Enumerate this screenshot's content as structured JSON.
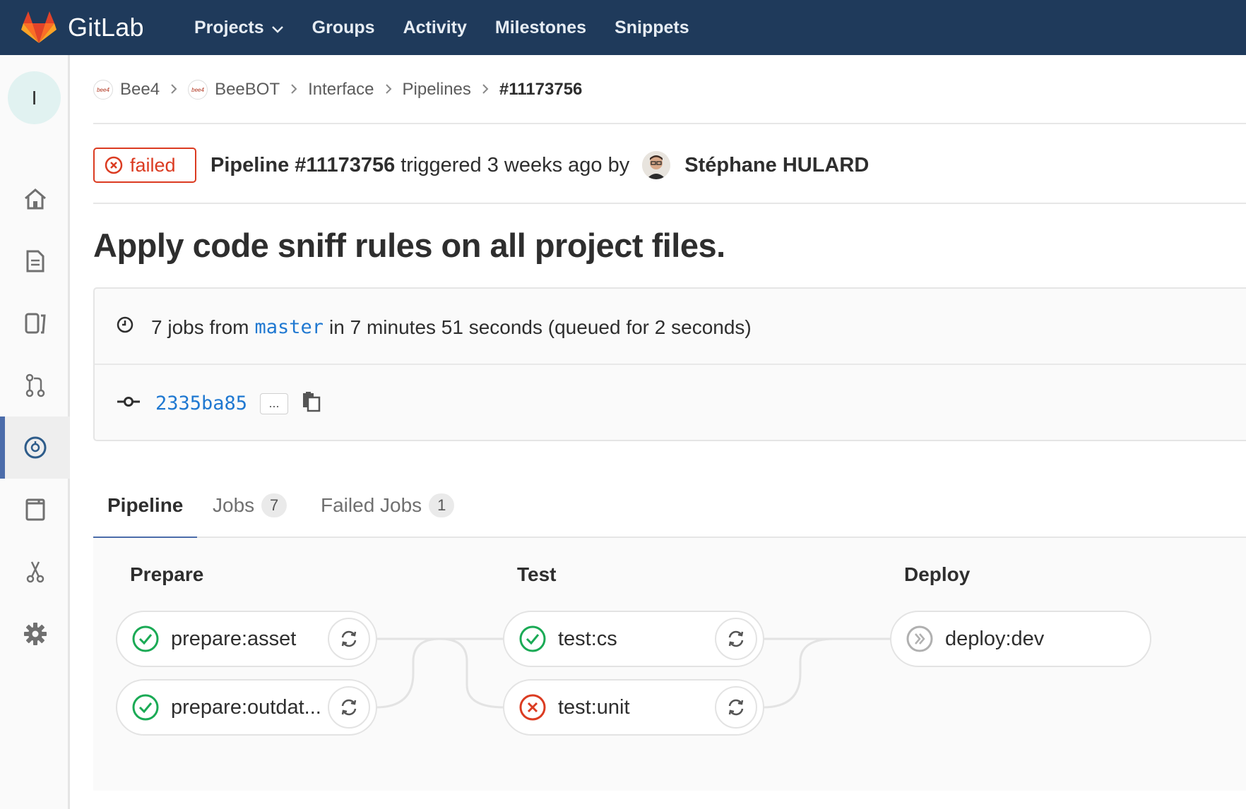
{
  "topnav": {
    "brand": "GitLab",
    "items": [
      "Projects",
      "Groups",
      "Activity",
      "Milestones",
      "Snippets"
    ]
  },
  "sidebar": {
    "avatar_letter": "I",
    "items": [
      "home",
      "overview",
      "issues",
      "merge-requests",
      "ci-cd",
      "wiki",
      "snippets",
      "settings"
    ],
    "active_item": "ci-cd"
  },
  "breadcrumb": {
    "items": [
      "Bee4",
      "BeeBOT",
      "Interface",
      "Pipelines"
    ],
    "current": "#11173756",
    "project_avatar_text": "bee4"
  },
  "pipeline": {
    "status": "failed",
    "title_prefix": "Pipeline #11173756",
    "triggered_text": "triggered 3 weeks ago by",
    "user": "Stéphane HULARD",
    "commit_title": "Apply code sniff rules on all project files.",
    "jobs_count_text": "7 jobs from",
    "branch": "master",
    "duration_text": "in 7 minutes 51 seconds (queued for 2 seconds)",
    "sha": "2335ba85",
    "ellipsis": "..."
  },
  "tabs": [
    {
      "label": "Pipeline",
      "count": null
    },
    {
      "label": "Jobs",
      "count": "7"
    },
    {
      "label": "Failed Jobs",
      "count": "1"
    }
  ],
  "stages": [
    {
      "title": "Prepare",
      "jobs": [
        {
          "name": "prepare:asset",
          "status": "success"
        },
        {
          "name": "prepare:outdat...",
          "status": "success"
        }
      ]
    },
    {
      "title": "Test",
      "jobs": [
        {
          "name": "test:cs",
          "status": "success"
        },
        {
          "name": "test:unit",
          "status": "failed"
        }
      ]
    },
    {
      "title": "Deploy",
      "jobs": [
        {
          "name": "deploy:dev",
          "status": "manual"
        }
      ]
    }
  ],
  "colors": {
    "navbar": "#1f3a5b",
    "success": "#1aaa55",
    "failed": "#db3b21",
    "link": "#1f78d1",
    "active_tab": "#4b6caa"
  }
}
